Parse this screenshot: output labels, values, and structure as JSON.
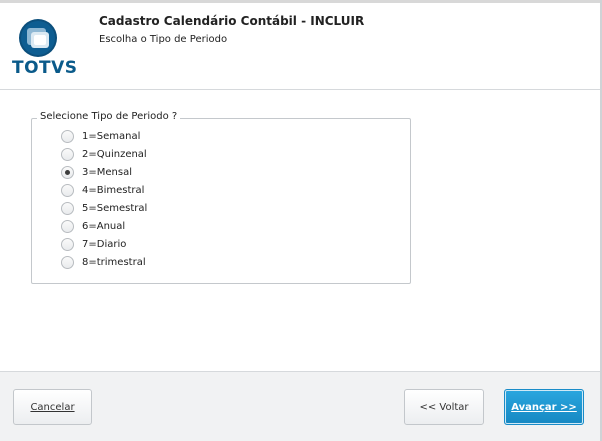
{
  "header": {
    "logo_text": "TOTVS",
    "title": "Cadastro Calendário Contábil - INCLUIR",
    "subtitle": "Escolha o Tipo de Periodo"
  },
  "group": {
    "legend": "Selecione Tipo de Periodo ?",
    "selected_index": 2,
    "options": [
      {
        "label": "1=Semanal",
        "checked": false
      },
      {
        "label": "2=Quinzenal",
        "checked": false
      },
      {
        "label": "3=Mensal",
        "checked": true
      },
      {
        "label": "4=Bimestral",
        "checked": false
      },
      {
        "label": "5=Semestral",
        "checked": false
      },
      {
        "label": "6=Anual",
        "checked": false
      },
      {
        "label": "7=Diario",
        "checked": false
      },
      {
        "label": "8=trimestral",
        "checked": false
      }
    ]
  },
  "footer": {
    "cancel_label": "Cancelar",
    "back_label": "<< Voltar",
    "next_label": "Avançar >>"
  },
  "colors": {
    "brand": "#0a5a8a",
    "primary_button": "#1c95d0"
  }
}
